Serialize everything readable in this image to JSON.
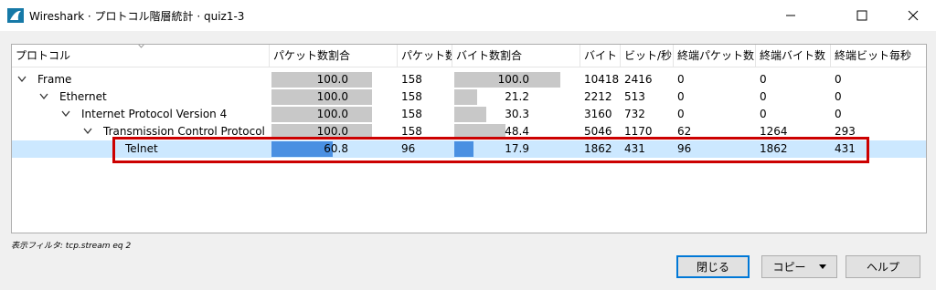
{
  "window": {
    "title": "Wireshark · プロトコル階層統計 · quiz1-3"
  },
  "columns": [
    "プロトコル",
    "パケット数割合",
    "パケット数",
    "バイト数割合",
    "バイト",
    "ビット/秒",
    "終端パケット数",
    "終端バイト数",
    "終端ビット毎秒"
  ],
  "rows": [
    {
      "protocol": "Frame",
      "pkt_pct": "100.0",
      "pkt_pct_value": 100.0,
      "packets": "158",
      "byte_pct": "100.0",
      "byte_pct_value": 100.0,
      "bytes": "10418",
      "bps": "2416",
      "end_packets": "0",
      "end_bytes": "0",
      "end_bps": "0"
    },
    {
      "protocol": "Ethernet",
      "pkt_pct": "100.0",
      "pkt_pct_value": 100.0,
      "packets": "158",
      "byte_pct": "21.2",
      "byte_pct_value": 21.2,
      "bytes": "2212",
      "bps": "513",
      "end_packets": "0",
      "end_bytes": "0",
      "end_bps": "0"
    },
    {
      "protocol": "Internet Protocol Version 4",
      "pkt_pct": "100.0",
      "pkt_pct_value": 100.0,
      "packets": "158",
      "byte_pct": "30.3",
      "byte_pct_value": 30.3,
      "bytes": "3160",
      "bps": "732",
      "end_packets": "0",
      "end_bytes": "0",
      "end_bps": "0"
    },
    {
      "protocol": "Transmission Control Protocol",
      "pkt_pct": "100.0",
      "pkt_pct_value": 100.0,
      "packets": "158",
      "byte_pct": "48.4",
      "byte_pct_value": 48.4,
      "bytes": "5046",
      "bps": "1170",
      "end_packets": "62",
      "end_bytes": "1264",
      "end_bps": "293"
    },
    {
      "protocol": "Telnet",
      "pkt_pct": "60.8",
      "pkt_pct_value": 60.8,
      "packets": "96",
      "byte_pct": "17.9",
      "byte_pct_value": 17.9,
      "bytes": "1862",
      "bps": "431",
      "end_packets": "96",
      "end_bytes": "1862",
      "end_bps": "431"
    }
  ],
  "display_filter": "表示フィルタ: tcp.stream eq 2",
  "buttons": {
    "close": "閉じる",
    "copy": "コピー",
    "help": "ヘルプ"
  },
  "colors": {
    "selection": "#cce8ff",
    "bar_selected": "#4a90e2",
    "bar": "#c8c8c8",
    "highlight": "#cc0000"
  }
}
